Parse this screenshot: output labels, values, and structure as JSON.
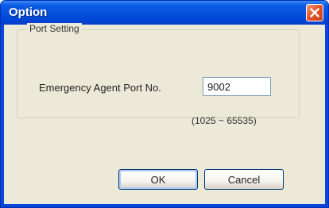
{
  "window": {
    "title": "Option",
    "close_icon": "close-icon"
  },
  "port_setting": {
    "group_label": "Port Setting",
    "field_label": "Emergency Agent Port No.",
    "port_value": "9002",
    "range_hint": "(1025 ~ 65535)"
  },
  "buttons": {
    "ok_label": "OK",
    "cancel_label": "Cancel"
  },
  "colors": {
    "titlebar": "#0552e0",
    "close_button": "#e5562c",
    "client_background": "#ece9d8"
  }
}
